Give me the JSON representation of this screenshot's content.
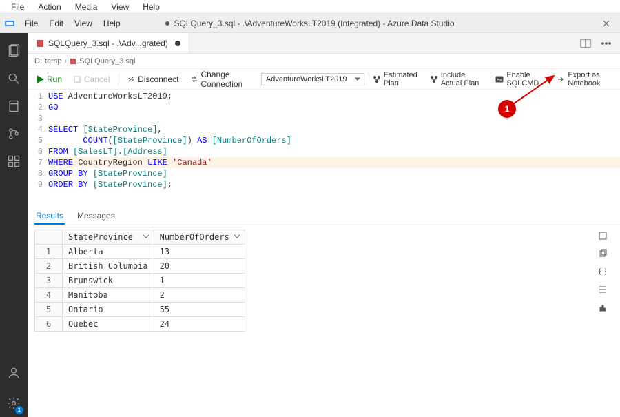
{
  "os_menu": [
    "File",
    "Action",
    "Media",
    "View",
    "Help"
  ],
  "app_menu": [
    "File",
    "Edit",
    "View",
    "Help"
  ],
  "app_title": "SQLQuery_3.sql - .\\AdventureWorksLT2019 (Integrated) - Azure Data Studio",
  "tab": {
    "label": "SQLQuery_3.sql - .\\Adv...grated)"
  },
  "breadcrumbs": {
    "root": "D:",
    "folder": "temp",
    "file": "SQLQuery_3.sql"
  },
  "toolbar": {
    "run": "Run",
    "cancel": "Cancel",
    "disconnect": "Disconnect",
    "change_connection": "Change Connection",
    "connection": "AdventureWorksLT2019",
    "estimated_plan": "Estimated Plan",
    "actual_plan": "Include Actual Plan",
    "enable_sqlcmd": "Enable SQLCMD",
    "export_notebook": "Export as Notebook"
  },
  "code_lines": [
    "USE AdventureWorksLT2019;",
    "GO",
    "",
    "SELECT [StateProvince],",
    "       COUNT([StateProvince]) AS [NumberOfOrders]",
    "FROM [SalesLT].[Address]",
    "WHERE CountryRegion LIKE 'Canada'",
    "GROUP BY [StateProvince]",
    "ORDER BY [StateProvince];"
  ],
  "result_tabs": {
    "results": "Results",
    "messages": "Messages"
  },
  "grid": {
    "columns": [
      "StateProvince",
      "NumberOfOrders"
    ],
    "rows": [
      {
        "idx": "1",
        "StateProvince": "Alberta",
        "NumberOfOrders": "13"
      },
      {
        "idx": "2",
        "StateProvince": "British Columbia",
        "NumberOfOrders": "20"
      },
      {
        "idx": "3",
        "StateProvince": "Brunswick",
        "NumberOfOrders": "1"
      },
      {
        "idx": "4",
        "StateProvince": "Manitoba",
        "NumberOfOrders": "2"
      },
      {
        "idx": "5",
        "StateProvince": "Ontario",
        "NumberOfOrders": "55"
      },
      {
        "idx": "6",
        "StateProvince": "Quebec",
        "NumberOfOrders": "24"
      }
    ]
  },
  "annotation": {
    "label": "1"
  },
  "activity_badge": "1"
}
